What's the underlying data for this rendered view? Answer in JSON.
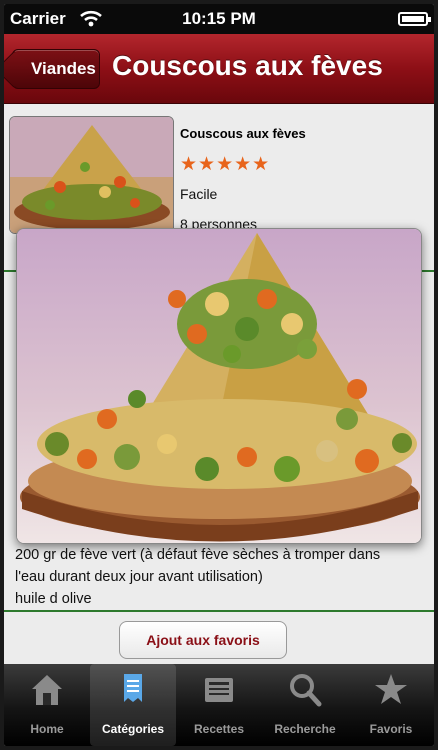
{
  "status": {
    "carrier": "Carrier",
    "time": "10:15 PM"
  },
  "nav": {
    "back_label": "Viandes",
    "title": "Couscous aux fèves"
  },
  "recipe": {
    "name": "Couscous aux fèves",
    "stars": "★★★★★",
    "difficulty": "Facile",
    "servings": "8 personnes"
  },
  "ingredients": {
    "line1": "200 gr de fève vert (à défaut fève sèches à tromper dans",
    "line2": "l'eau durant deux jour avant utilisation)",
    "line3": "huile d olive"
  },
  "favorites_button": "Ajout aux favoris",
  "tabs": [
    {
      "label": "Home",
      "icon": "home-icon"
    },
    {
      "label": "Catégories",
      "icon": "document-icon"
    },
    {
      "label": "Recettes",
      "icon": "newspaper-icon"
    },
    {
      "label": "Recherche",
      "icon": "search-icon"
    },
    {
      "label": "Favoris",
      "icon": "star-icon"
    }
  ],
  "colors": {
    "nav": "#8d0f16",
    "stars": "#e8641b",
    "accent_line": "#2e7a2e"
  }
}
